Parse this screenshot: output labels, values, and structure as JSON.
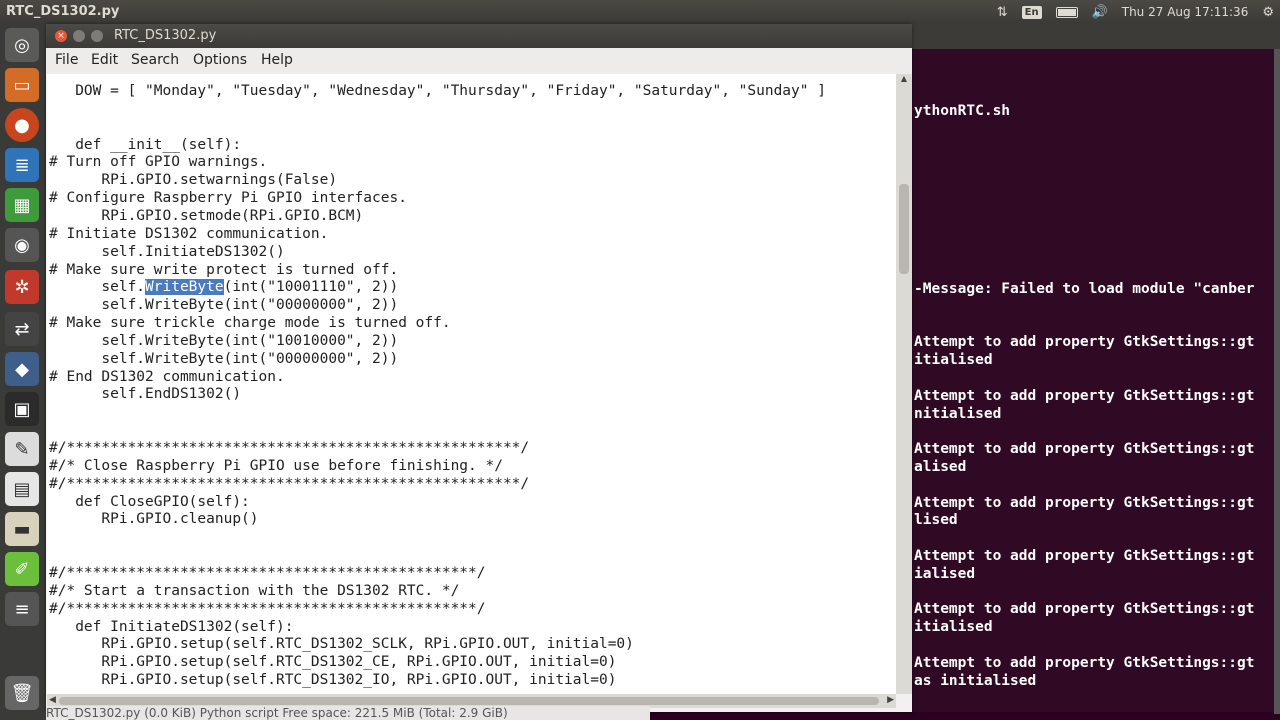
{
  "top_panel": {
    "title": "RTC_DS1302.py",
    "lang": "En",
    "clock": "Thu 27 Aug 17:11:36"
  },
  "launcher": {
    "items": [
      "dash-icon",
      "files-icon",
      "firefox-icon",
      "writer-icon",
      "calc-icon",
      "camera-icon",
      "settings-icon",
      "network-icon",
      "terminal-icon",
      "text-editor-icon",
      "calculator-icon",
      "files-window-icon",
      "gedit-icon",
      "disk-icon",
      "trash-icon"
    ]
  },
  "editor": {
    "title": "RTC_DS1302.py",
    "menu": [
      "File",
      "Edit",
      "Search",
      "Options",
      "Help"
    ],
    "selected_word": "WriteByte",
    "lines": [
      "   DOW = [ \"Monday\", \"Tuesday\", \"Wednesday\", \"Thursday\", \"Friday\", \"Saturday\", \"Sunday\" ]",
      "",
      "",
      "   def __init__(self):",
      "# Turn off GPIO warnings.",
      "      RPi.GPIO.setwarnings(False)",
      "# Configure Raspberry Pi GPIO interfaces.",
      "      RPi.GPIO.setmode(RPi.GPIO.BCM)",
      "# Initiate DS1302 communication.",
      "      self.InitiateDS1302()",
      "# Make sure write protect is turned off.",
      "      self.WriteByte(int(\"10001110\", 2))",
      "      self.WriteByte(int(\"00000000\", 2))",
      "# Make sure trickle charge mode is turned off.",
      "      self.WriteByte(int(\"10010000\", 2))",
      "      self.WriteByte(int(\"00000000\", 2))",
      "# End DS1302 communication.",
      "      self.EndDS1302()",
      "",
      "",
      "#/****************************************************/",
      "#/* Close Raspberry Pi GPIO use before finishing. */",
      "#/****************************************************/",
      "   def CloseGPIO(self):",
      "      RPi.GPIO.cleanup()",
      "",
      "",
      "#/***********************************************/",
      "#/* Start a transaction with the DS1302 RTC. */",
      "#/***********************************************/",
      "   def InitiateDS1302(self):",
      "      RPi.GPIO.setup(self.RTC_DS1302_SCLK, RPi.GPIO.OUT, initial=0)",
      "      RPi.GPIO.setup(self.RTC_DS1302_CE, RPi.GPIO.OUT, initial=0)",
      "      RPi.GPIO.setup(self.RTC_DS1302_IO, RPi.GPIO.OUT, initial=0)"
    ]
  },
  "terminal": {
    "lines": [
      {
        "row": 1,
        "text": "ythonRTC.sh"
      },
      {
        "row": 11,
        "text": "-Message: Failed to load module \"canber"
      },
      {
        "row": 14,
        "text": "Attempt to add property GtkSettings::gt"
      },
      {
        "row": 15,
        "text": "itialised"
      },
      {
        "row": 17,
        "text": "Attempt to add property GtkSettings::gt"
      },
      {
        "row": 18,
        "text": "nitialised"
      },
      {
        "row": 20,
        "text": "Attempt to add property GtkSettings::gt"
      },
      {
        "row": 21,
        "text": "alised"
      },
      {
        "row": 23,
        "text": "Attempt to add property GtkSettings::gt"
      },
      {
        "row": 24,
        "text": "lised"
      },
      {
        "row": 26,
        "text": "Attempt to add property GtkSettings::gt"
      },
      {
        "row": 27,
        "text": "ialised"
      },
      {
        "row": 29,
        "text": "Attempt to add property GtkSettings::gt"
      },
      {
        "row": 30,
        "text": "itialised"
      },
      {
        "row": 32,
        "text": "Attempt to add property GtkSettings::gt"
      },
      {
        "row": 33,
        "text": "as initialised"
      }
    ]
  },
  "statusbar": {
    "text": "RTC_DS1302.py  (0.0 KiB) Python script    Free space: 221.5 MiB (Total: 2.9 GiB)"
  },
  "colors": {
    "terminal_bg": "#300a24",
    "selection": "#4a7bbd",
    "close_button": "#e9573a"
  }
}
